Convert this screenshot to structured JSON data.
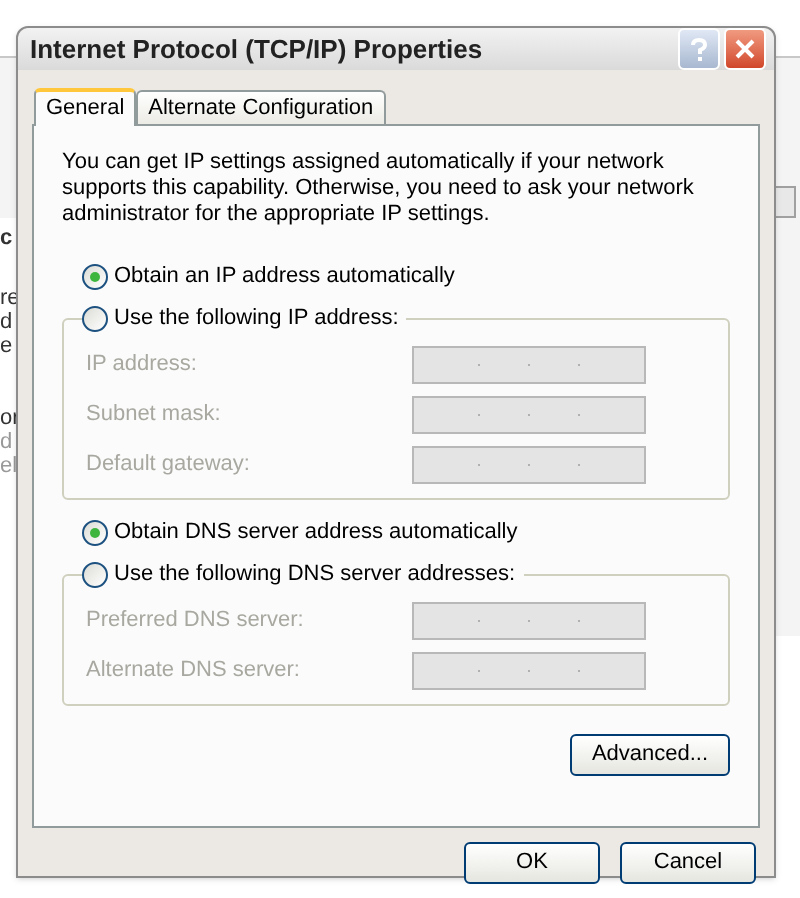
{
  "background_fragments": [
    "c",
    "re",
    "d",
    "e",
    "or",
    "d",
    "el"
  ],
  "window": {
    "title": "Internet Protocol (TCP/IP) Properties"
  },
  "tabs": [
    {
      "label": "General",
      "selected": true
    },
    {
      "label": "Alternate Configuration",
      "selected": false
    }
  ],
  "description": "You can get IP settings assigned automatically if your network supports this capability. Otherwise, you need to ask your network administrator for the appropriate IP settings.",
  "ip_section": {
    "options": [
      {
        "label": "Obtain an IP address automatically",
        "selected": true
      },
      {
        "label": "Use the following IP address:",
        "selected": false
      }
    ],
    "fields": [
      {
        "label": "IP address:",
        "disabled": true
      },
      {
        "label": "Subnet mask:",
        "disabled": true
      },
      {
        "label": "Default gateway:",
        "disabled": true
      }
    ]
  },
  "dns_section": {
    "options": [
      {
        "label": "Obtain DNS server address automatically",
        "selected": true
      },
      {
        "label": "Use the following DNS server addresses:",
        "selected": false
      }
    ],
    "fields": [
      {
        "label": "Preferred DNS server:",
        "disabled": true
      },
      {
        "label": "Alternate DNS server:",
        "disabled": true
      }
    ]
  },
  "buttons": {
    "advanced": "Advanced...",
    "ok": "OK",
    "cancel": "Cancel"
  }
}
